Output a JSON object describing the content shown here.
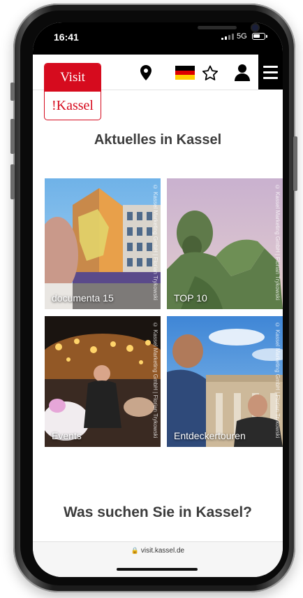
{
  "status_bar": {
    "time": "16:41",
    "network": "5G"
  },
  "header": {
    "logo_top": "Visit",
    "logo_bottom": "!Kassel",
    "icons": [
      "location-pin-icon",
      "german-flag-icon",
      "star-icon",
      "user-icon",
      "hamburger-menu-icon"
    ]
  },
  "main": {
    "section_title": "Aktuelles in Kassel",
    "tiles": [
      {
        "label": "documenta 15",
        "copyright": "© Kassel Marketing GmbH | Florian Trykowski"
      },
      {
        "label": "TOP 10",
        "copyright": "© Kassel Marketing GmbH | Florian Trykowski"
      },
      {
        "label": "Events",
        "copyright": "© Kassel Marketing GmbH | Florian Trykowski"
      },
      {
        "label": "Entdeckertouren",
        "copyright": "© Kassel Marketing GmbH | Florian Trykowski"
      }
    ],
    "section2_title": "Was suchen Sie in Kassel?"
  },
  "browser": {
    "url": "visit.kassel.de"
  },
  "colors": {
    "brand_red": "#d60b1e",
    "text_dark": "#3c3c3c",
    "header_black": "#000000"
  }
}
